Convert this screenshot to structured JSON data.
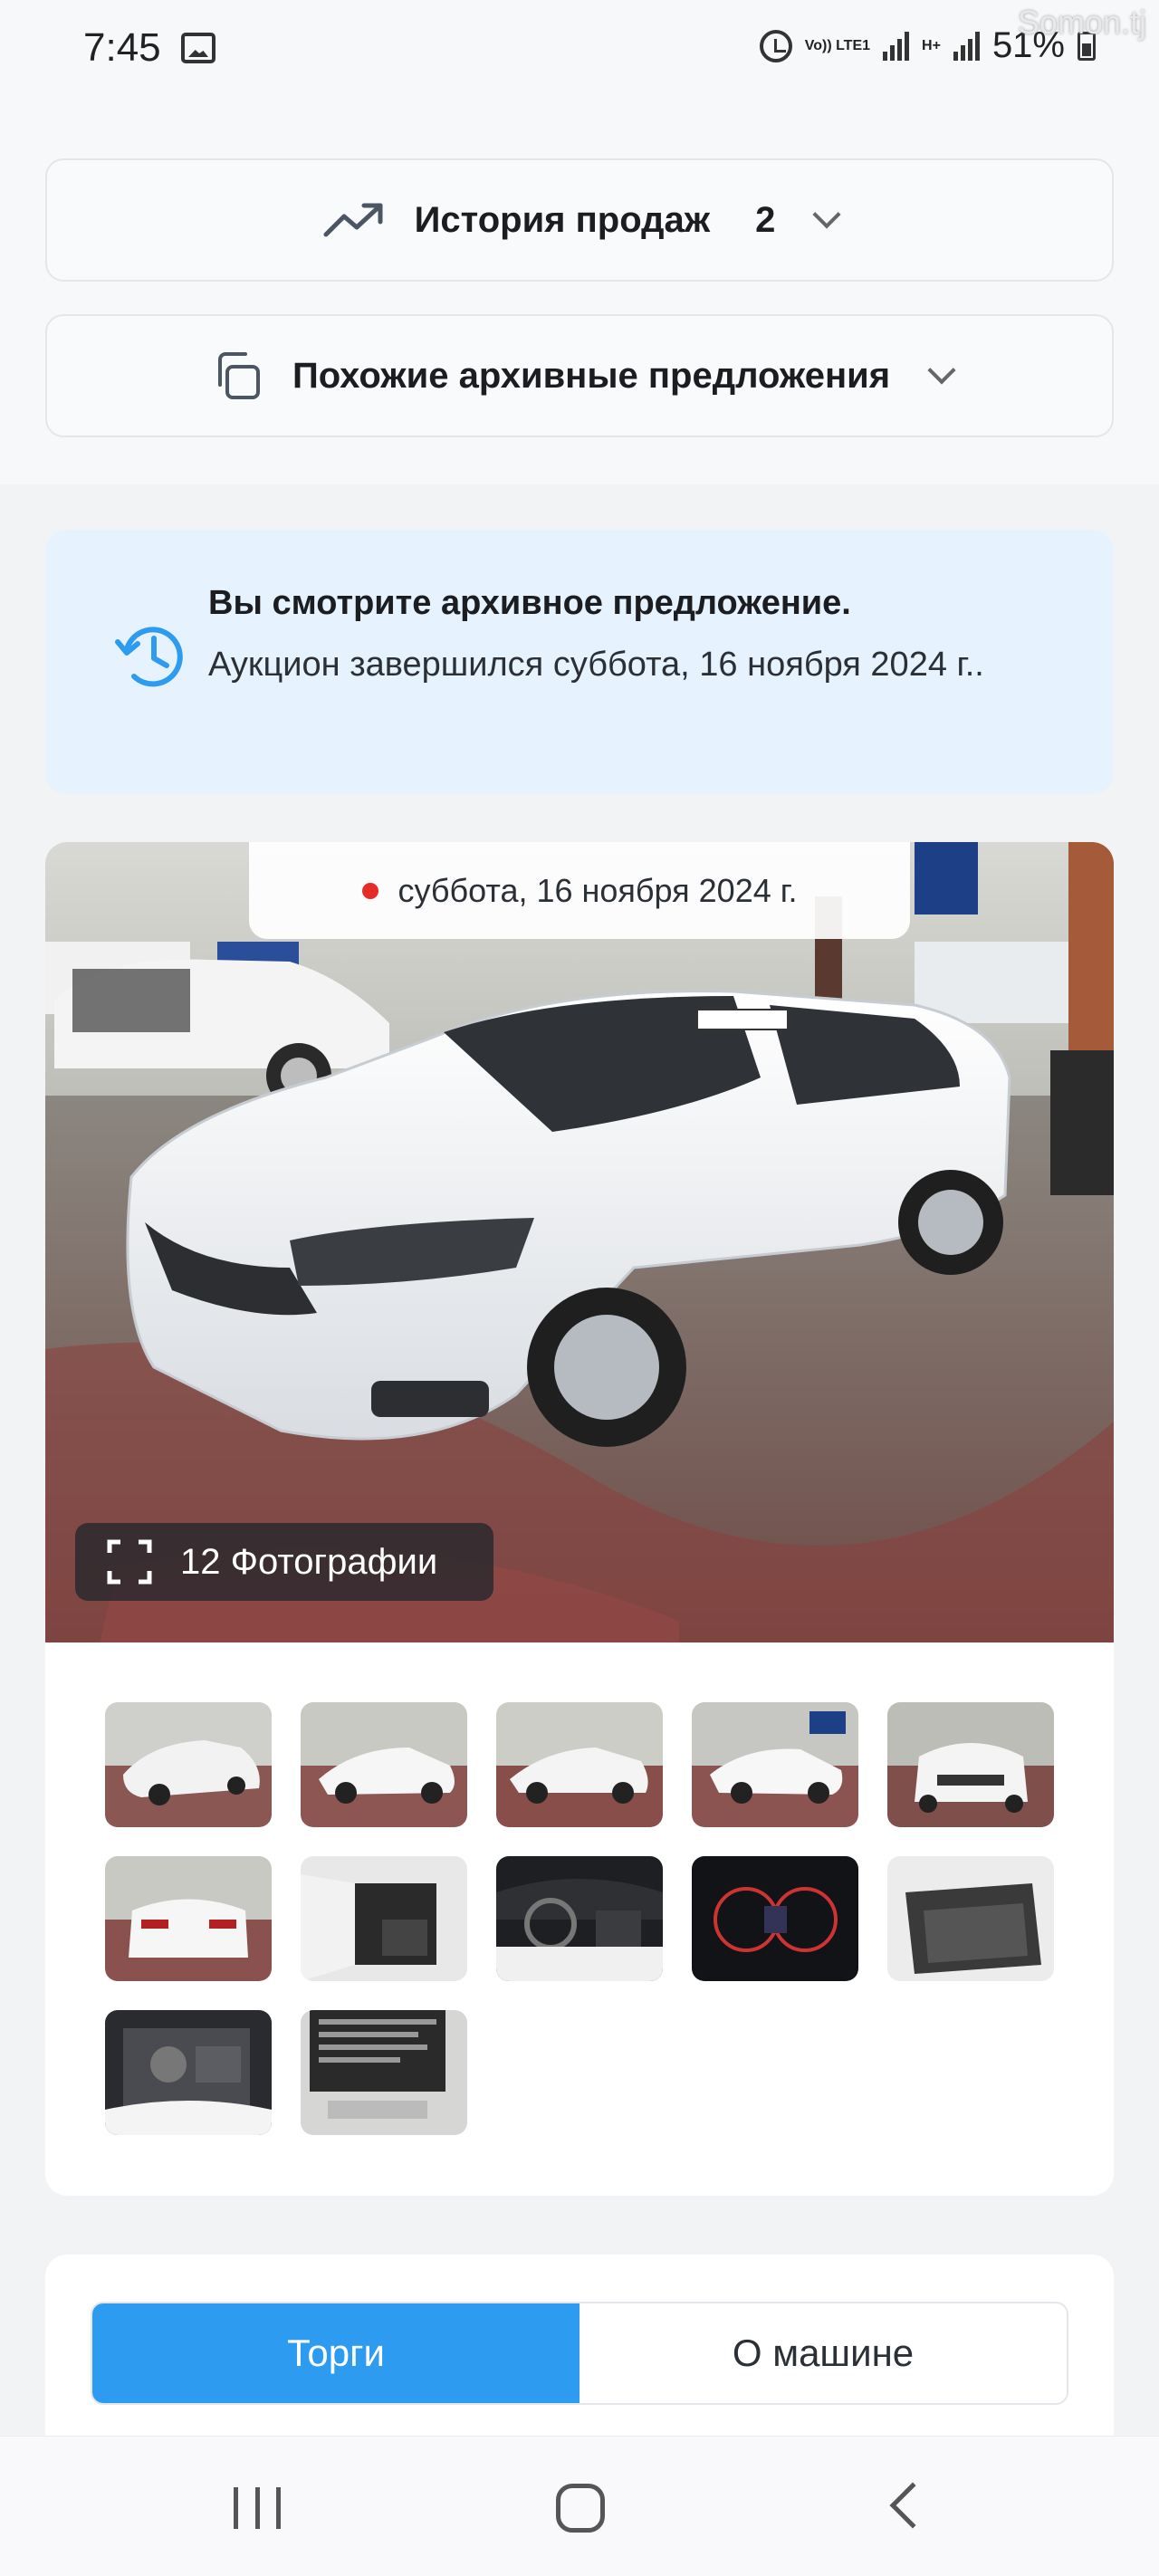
{
  "status_bar": {
    "time": "7:45",
    "network_label": "Vo)) LTE1",
    "network_label_2": "H+",
    "battery": "51%",
    "watermark": "Somon.tj"
  },
  "accordions": [
    {
      "title": "История продаж",
      "count": "2",
      "icon": "trend-up-icon"
    },
    {
      "title": "Похожие архивные предложения",
      "icon": "copy-icon"
    }
  ],
  "notice": {
    "title": "Вы смотрите архивное предложение.",
    "text": "Аукцион завершился суббота, 16 ноября 2024 г..",
    "icon": "history-icon",
    "color": "#e6f2fd"
  },
  "gallery": {
    "date": "суббота, 16 ноября 2024 г.",
    "photo_count_label": "12 Фотографии",
    "thumbnails": [
      "car-exterior-front-left",
      "car-exterior-side",
      "car-exterior-side-2",
      "car-exterior-rear-3q",
      "car-exterior-front",
      "car-exterior-rear",
      "car-interior-door",
      "car-interior-dashboard",
      "car-instrument-cluster",
      "car-interior-rear-seats",
      "car-engine-bay",
      "car-label-sticker"
    ]
  },
  "tabs": {
    "active": "Торги",
    "inactive": "О машине",
    "accent": "#2d9cf0"
  },
  "navbar": {
    "icons": [
      "recent-apps-icon",
      "home-icon",
      "back-icon"
    ]
  }
}
